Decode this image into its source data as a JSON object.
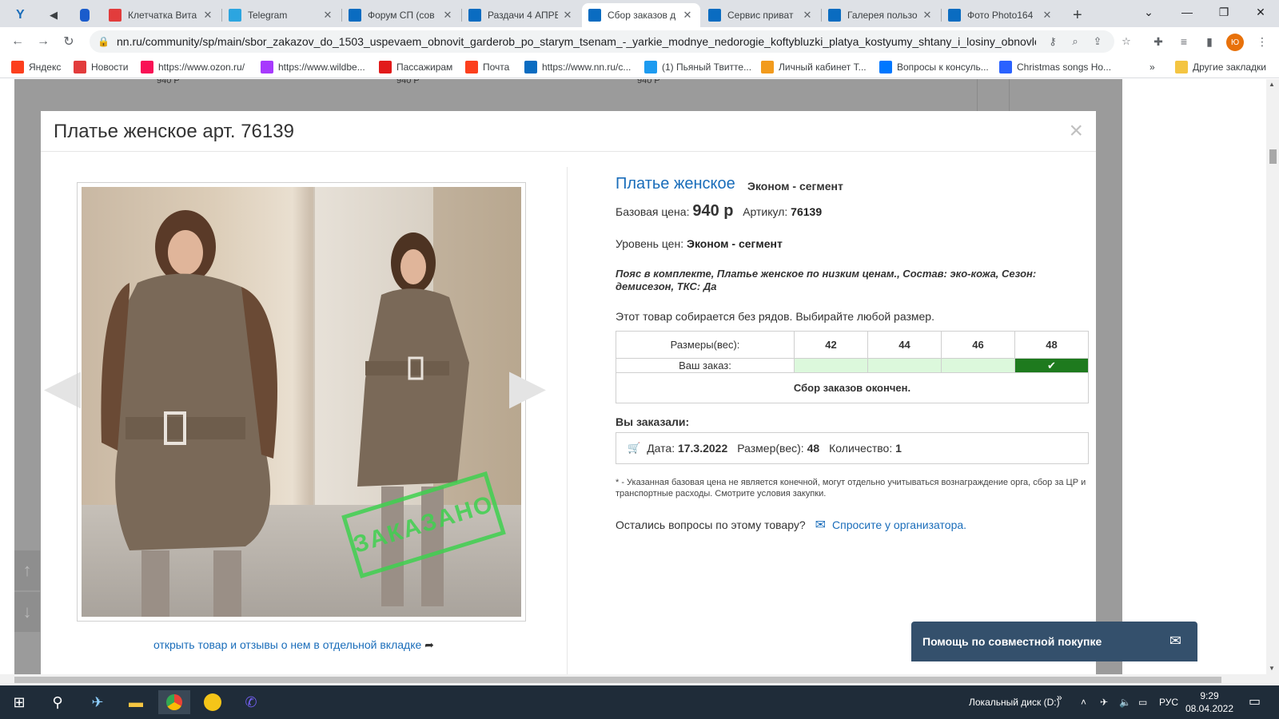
{
  "browser": {
    "tabs": [
      {
        "title": "Клетчатка Вита",
        "color": "#e23c3c",
        "active": false
      },
      {
        "title": "Telegram",
        "color": "#2ca5e0",
        "active": false
      },
      {
        "title": "Форум СП (сов",
        "color": "#0a6cc1",
        "active": false
      },
      {
        "title": "Раздачи 4 АПРЕ",
        "color": "#0a6cc1",
        "active": false
      },
      {
        "title": "Сбор заказов д",
        "color": "#0a6cc1",
        "active": true
      },
      {
        "title": "Сервис приват",
        "color": "#0a6cc1",
        "active": false
      },
      {
        "title": "Галерея пользо",
        "color": "#0a6cc1",
        "active": false
      },
      {
        "title": "Фото Photo164",
        "color": "#0a6cc1",
        "active": false
      }
    ],
    "url": "nn.ru/community/sp/main/sbor_zakazov_do_1503_uspevaem_obnovit_garderob_po_starym_tsenam_-_yarkie_modnye_nedorogie_koftybluzki_platya_kostyumy_shtany_i_losiny_obnovleni...",
    "profile_initial": "Ю",
    "bookmarks": [
      {
        "label": "Яндекс",
        "color": "#fc3f1d"
      },
      {
        "label": "Новости",
        "color": "#e23c3c"
      },
      {
        "label": "https://www.ozon.ru/",
        "color": "#f91155"
      },
      {
        "label": "https://www.wildbe...",
        "color": "#a73afd"
      },
      {
        "label": "Пассажирам",
        "color": "#e21a1a"
      },
      {
        "label": "Почта",
        "color": "#fc3f1d"
      },
      {
        "label": "https://www.nn.ru/c...",
        "color": "#0a6cc1"
      },
      {
        "label": "(1) Пьяный Твитте...",
        "color": "#1d9bf0"
      },
      {
        "label": "Личный кабинет Т...",
        "color": "#f29b1d"
      },
      {
        "label": "Вопросы к консуль...",
        "color": "#0077ff"
      },
      {
        "label": "Christmas songs Ho...",
        "color": "#2a62ff"
      }
    ],
    "bookmarks_more": "»",
    "other_bookmarks": "Другие закладки"
  },
  "background_page": {
    "prices": [
      "940 Р",
      "940 Р",
      "940 Р"
    ]
  },
  "modal": {
    "title": "Платье женское арт. 76139",
    "close": "×",
    "open_link": "открыть товар и отзывы о нем в отдельной вкладке",
    "stamp": "ЗАКАЗАНО",
    "product": {
      "name": "Платье женское",
      "segment": "Эконом - сегмент",
      "base_price_label": "Базовая цена:",
      "base_price": "940 р",
      "article_label": "Артикул:",
      "article": "76139",
      "price_level_label": "Уровень цен:",
      "price_level": "Эконом - сегмент",
      "description": "Пояс в комплекте, Платье женское по низким ценам., Состав: эко-кожа, Сезон: демисезон, ТКС: Да",
      "no_rows_note": "Этот товар собирается без рядов. Выбирайте любой размер."
    },
    "sizes_table": {
      "sizes_label": "Размеры(вес):",
      "sizes": [
        "42",
        "44",
        "46",
        "48"
      ],
      "order_label": "Ваш заказ:",
      "selected_size": "48",
      "check": "✔",
      "closed": "Сбор заказов окончен."
    },
    "ordered": {
      "title": "Вы заказали:",
      "date_label": "Дата:",
      "date": "17.3.2022",
      "size_label": "Размер(вес):",
      "size": "48",
      "qty_label": "Количество:",
      "qty": "1"
    },
    "footnote": "* - Указанная базовая цена не является конечной, могут отдельно учитываться вознаграждение орга, сбор за ЦР и транспортные расходы. Смотрите условия закупки.",
    "ask_text": "Остались вопросы по этому товару?",
    "ask_link": "Спросите у организатора."
  },
  "help_widget": "Помощь по совместной покупке",
  "taskbar": {
    "disk": "Локальный диск (D:)",
    "lang": "РУС",
    "time": "9:29",
    "date": "08.04.2022"
  }
}
